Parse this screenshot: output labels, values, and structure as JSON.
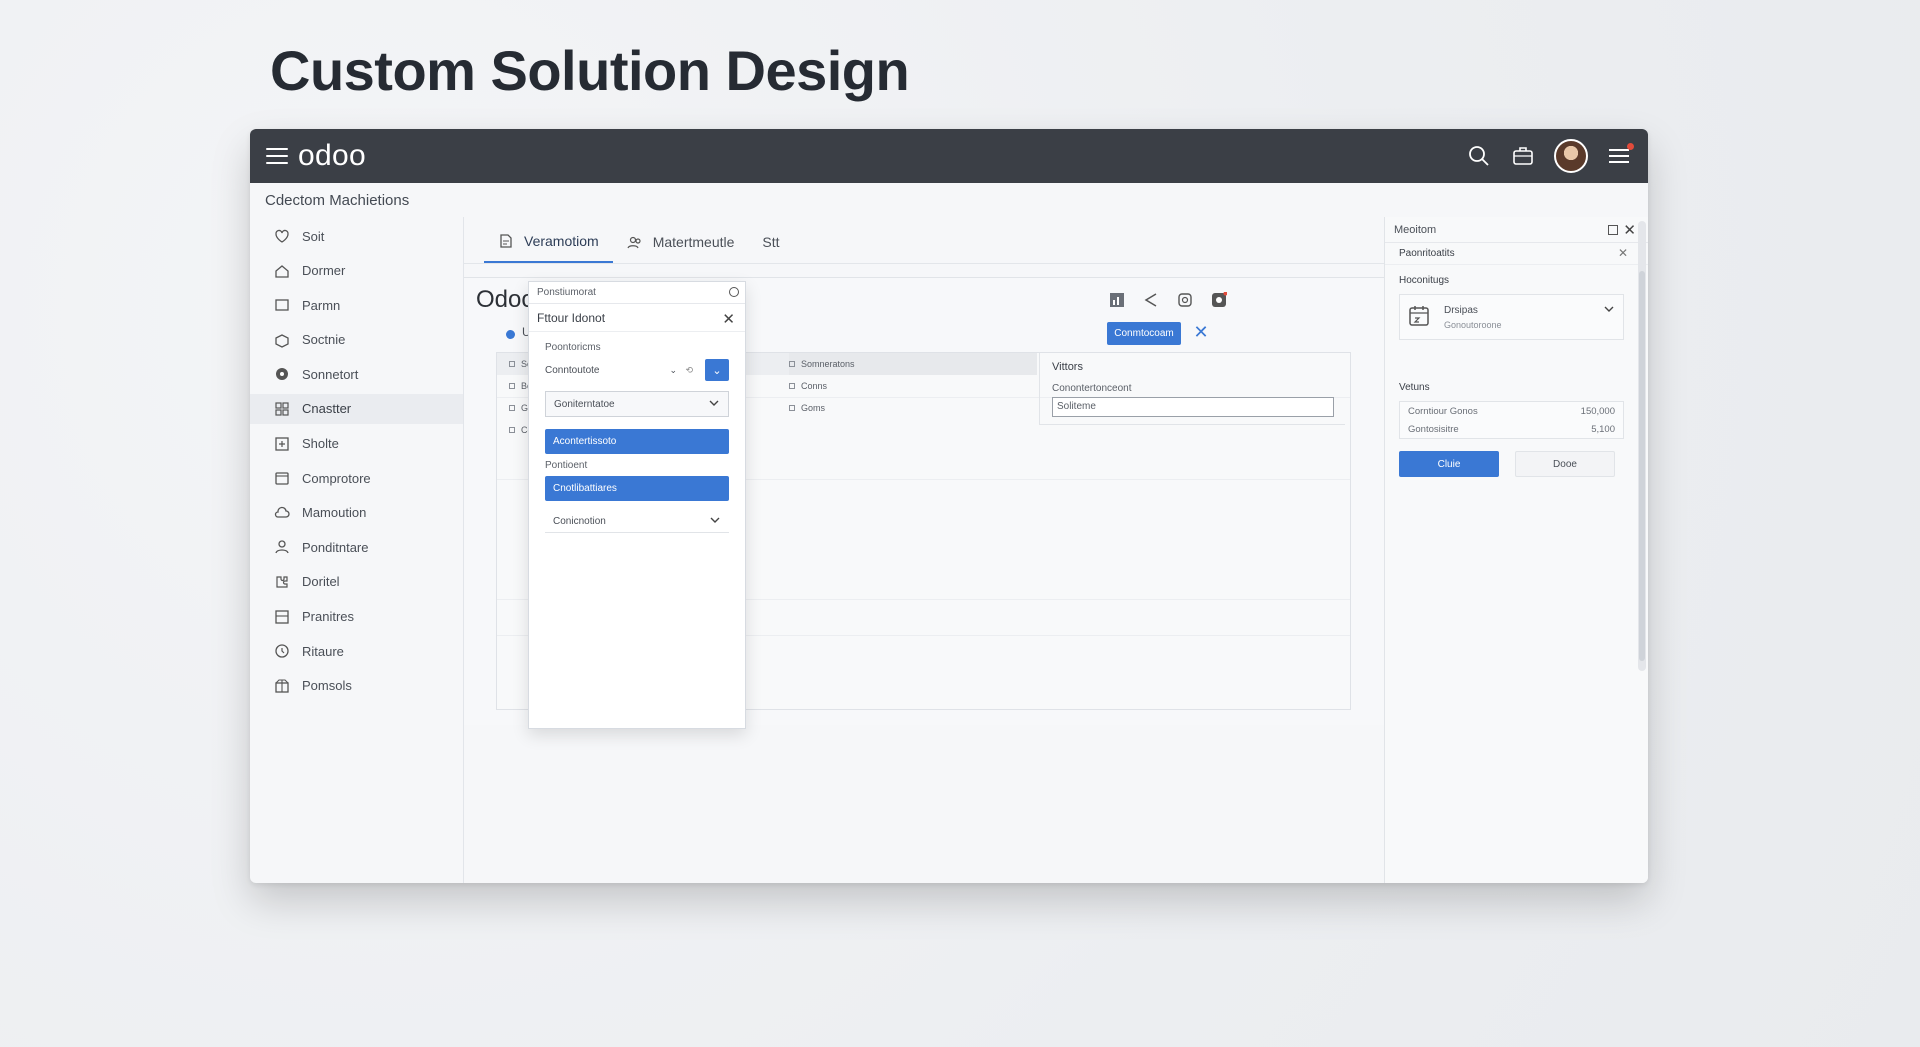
{
  "headline": "Custom Solution Design",
  "app": {
    "brand": "odoo",
    "breadcrumb": "Cdectom Machietions"
  },
  "sidebar": {
    "items": [
      {
        "label": "Soit",
        "icon": "heart-icon"
      },
      {
        "label": "Dormer",
        "icon": "home-icon"
      },
      {
        "label": "Parmn",
        "icon": "square-icon"
      },
      {
        "label": "Soctnie",
        "icon": "box-icon"
      },
      {
        "label": "Sonnetort",
        "icon": "circle-icon"
      },
      {
        "label": "Cnastter",
        "icon": "grid-icon"
      },
      {
        "label": "Sholte",
        "icon": "plus-box-icon"
      },
      {
        "label": "Comprotore",
        "icon": "calendar-icon"
      },
      {
        "label": "Mamoution",
        "icon": "cloud-icon"
      },
      {
        "label": "Ponditntare",
        "icon": "user-icon"
      },
      {
        "label": "Doritel",
        "icon": "puzzle-icon"
      },
      {
        "label": "Pranitres",
        "icon": "table-icon"
      },
      {
        "label": "Ritaure",
        "icon": "clock-icon"
      },
      {
        "label": "Pomsols",
        "icon": "package-icon"
      }
    ],
    "active_index": 5
  },
  "tabs": [
    {
      "label": "Veramotiom",
      "icon": "document-icon"
    },
    {
      "label": "Matertmeutle",
      "icon": "users-icon"
    },
    {
      "label": "Stt",
      "icon": ""
    }
  ],
  "form": {
    "title": "Odoo",
    "status": "Ure",
    "create_label": "Conmtocoam",
    "grid_left": [
      "Soo",
      "Boo",
      "Goo",
      "Cor"
    ],
    "grid_mid": [
      "Somneratons",
      "Conns",
      "Goms"
    ],
    "values_title": "Vittors",
    "values_label": "Conontertonceont",
    "values_input": "Soliteme"
  },
  "dropdown": {
    "header": "Ponstiumorat",
    "title": "Fttour Idonot",
    "section_label": "Poontoricms",
    "row_value": "Conntoutote",
    "row_mini": "⌄",
    "row_mini2": "⟲",
    "select1": "Goniterntatoe",
    "blue1": "Acontertissoto",
    "plain_label": "Pontioent",
    "blue2": "Cnotlibattiares",
    "select2": "Conicnotion"
  },
  "right_panel": {
    "header": "Meoitom",
    "sub": "Paonritoatits",
    "label": "Hoconitugs",
    "card_title": "Drsipas",
    "card_sub": "Gonoutoroone",
    "values_label": "Vetuns",
    "rows": [
      {
        "k": "Corntiour Gonos",
        "v": "150,000"
      },
      {
        "k": "Gontosisitre",
        "v": "5,100"
      }
    ],
    "primary_btn": "Cluie",
    "ghost_btn": "Dooe"
  },
  "colors": {
    "accent": "#3a78d4",
    "topbar": "#3b3f46",
    "badge": "#e24b3b"
  }
}
